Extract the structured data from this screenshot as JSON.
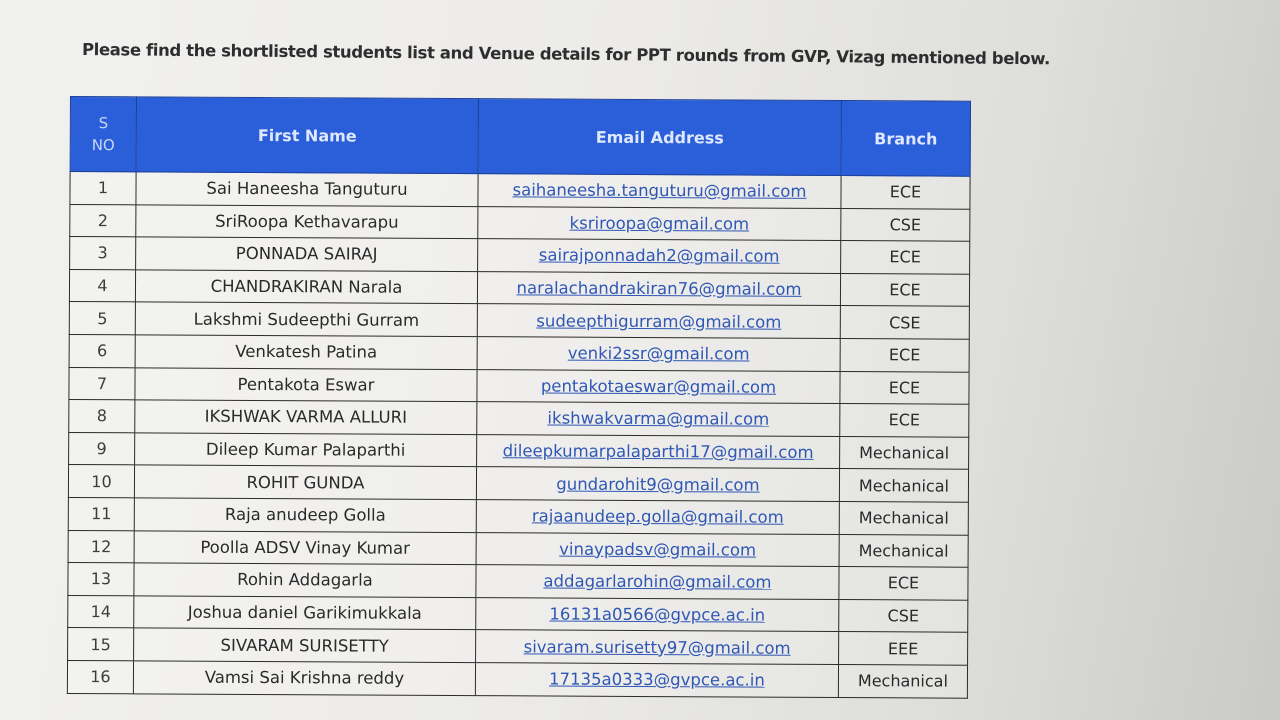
{
  "intro": "Please find the shortlisted students list and Venue details for PPT rounds  from GVP, Vizag mentioned below.",
  "table": {
    "headers": {
      "sno_line1": "S",
      "sno_line2": "NO",
      "first_name": "First Name",
      "email": "Email Address",
      "branch": "Branch"
    },
    "rows": [
      {
        "no": "1",
        "name": "Sai Haneesha Tanguturu",
        "email": "saihaneesha.tanguturu@gmail.com",
        "branch": "ECE"
      },
      {
        "no": "2",
        "name": "SriRoopa Kethavarapu",
        "email": "ksriroopa@gmail.com",
        "branch": "CSE"
      },
      {
        "no": "3",
        "name": "PONNADA SAIRAJ",
        "email": "sairajponnadah2@gmail.com",
        "branch": "ECE"
      },
      {
        "no": "4",
        "name": "CHANDRAKIRAN Narala",
        "email": "naralachandrakiran76@gmail.com",
        "branch": "ECE"
      },
      {
        "no": "5",
        "name": "Lakshmi Sudeepthi Gurram",
        "email": "sudeepthigurram@gmail.com",
        "branch": "CSE"
      },
      {
        "no": "6",
        "name": "Venkatesh Patina",
        "email": "venki2ssr@gmail.com",
        "branch": "ECE"
      },
      {
        "no": "7",
        "name": "Pentakota Eswar",
        "email": "pentakotaeswar@gmail.com",
        "branch": "ECE"
      },
      {
        "no": "8",
        "name": "IKSHWAK VARMA ALLURI",
        "email": "ikshwakvarma@gmail.com",
        "branch": "ECE"
      },
      {
        "no": "9",
        "name": "Dileep Kumar Palaparthi",
        "email": "dileepkumarpalaparthi17@gmail.com",
        "branch": "Mechanical"
      },
      {
        "no": "10",
        "name": "ROHIT GUNDA",
        "email": "gundarohit9@gmail.com",
        "branch": "Mechanical"
      },
      {
        "no": "11",
        "name": "Raja anudeep Golla",
        "email": "rajaanudeep.golla@gmail.com",
        "branch": "Mechanical"
      },
      {
        "no": "12",
        "name": "Poolla ADSV Vinay Kumar",
        "email": "vinaypadsv@gmail.com",
        "branch": "Mechanical"
      },
      {
        "no": "13",
        "name": "Rohin Addagarla",
        "email": "addagarlarohin@gmail.com",
        "branch": "ECE"
      },
      {
        "no": "14",
        "name": "Joshua daniel Garikimukkala",
        "email": "16131a0566@gvpce.ac.in",
        "branch": "CSE"
      },
      {
        "no": "15",
        "name": "SIVARAM SURISETTY",
        "email": "sivaram.surisetty97@gmail.com",
        "branch": "EEE"
      },
      {
        "no": "16",
        "name": "Vamsi Sai Krishna reddy",
        "email": "17135a0333@gvpce.ac.in",
        "branch": "Mechanical"
      }
    ]
  }
}
